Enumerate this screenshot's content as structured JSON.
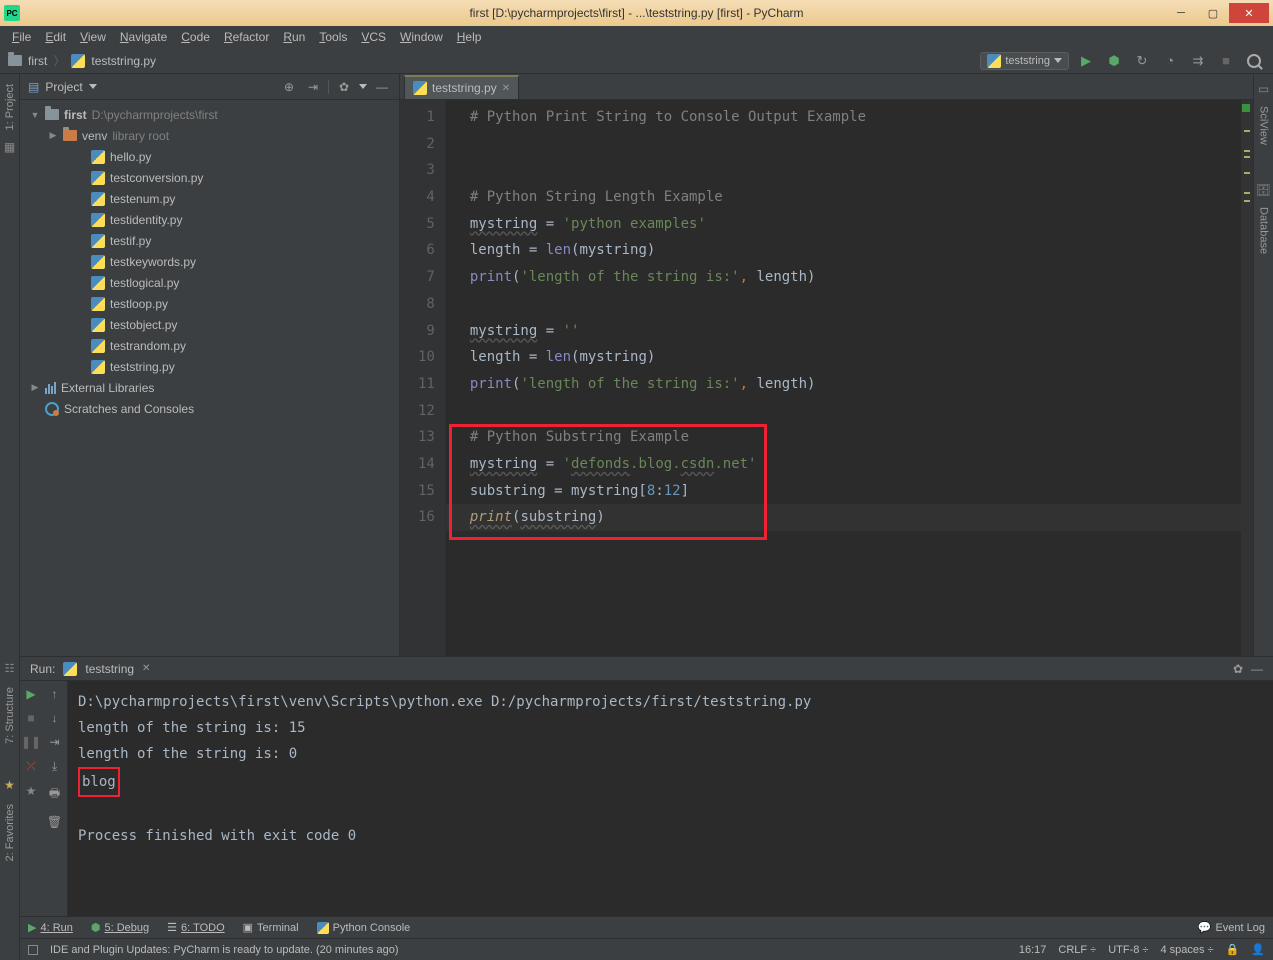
{
  "window": {
    "title": "first [D:\\pycharmprojects\\first] - ...\\teststring.py [first] - PyCharm",
    "min": "─",
    "max": "▢",
    "close": "✕"
  },
  "menu": {
    "items": [
      "File",
      "Edit",
      "View",
      "Navigate",
      "Code",
      "Refactor",
      "Run",
      "Tools",
      "VCS",
      "Window",
      "Help"
    ]
  },
  "breadcrumb": {
    "root": "first",
    "file": "teststring.py"
  },
  "toolbar": {
    "run_config": "teststring"
  },
  "left_rail": {
    "project": "1: Project"
  },
  "right_rail": {
    "sciview": "SciView",
    "database": "Database"
  },
  "left_fav": {
    "structure": "7: Structure",
    "favorites": "2: Favorites"
  },
  "project": {
    "title": "Project",
    "root": "first",
    "root_path": "D:\\pycharmprojects\\first",
    "venv": "venv",
    "venv_note": "library root",
    "files": [
      "hello.py",
      "testconversion.py",
      "testenum.py",
      "testidentity.py",
      "testif.py",
      "testkeywords.py",
      "testlogical.py",
      "testloop.py",
      "testobject.py",
      "testrandom.py",
      "teststring.py"
    ],
    "external": "External Libraries",
    "scratches": "Scratches and Consoles"
  },
  "editor": {
    "tab": "teststring.py",
    "lines": [
      {
        "n": "1",
        "seg": [
          {
            "t": "# Python Print String to Console Output Example",
            "c": "c-com"
          }
        ]
      },
      {
        "n": "2",
        "seg": []
      },
      {
        "n": "3",
        "seg": []
      },
      {
        "n": "4",
        "seg": [
          {
            "t": "# Python String Length Example",
            "c": "c-com"
          }
        ]
      },
      {
        "n": "5",
        "seg": [
          {
            "t": "mystring",
            "c": "c-id c-und"
          },
          {
            "t": " = ",
            "c": "c-id"
          },
          {
            "t": "'python examples'",
            "c": "c-str"
          }
        ]
      },
      {
        "n": "6",
        "seg": [
          {
            "t": "length = ",
            "c": "c-id"
          },
          {
            "t": "len",
            "c": "c-fn"
          },
          {
            "t": "(mystring)",
            "c": "c-id"
          }
        ]
      },
      {
        "n": "7",
        "seg": [
          {
            "t": "print",
            "c": "c-fn"
          },
          {
            "t": "(",
            "c": "c-id"
          },
          {
            "t": "'length of the string is:'",
            "c": "c-str"
          },
          {
            "t": ", ",
            "c": "c-key"
          },
          {
            "t": "length)",
            "c": "c-id"
          }
        ]
      },
      {
        "n": "8",
        "seg": []
      },
      {
        "n": "9",
        "seg": [
          {
            "t": "mystring",
            "c": "c-id c-und"
          },
          {
            "t": " = ",
            "c": "c-id"
          },
          {
            "t": "''",
            "c": "c-str"
          }
        ]
      },
      {
        "n": "10",
        "seg": [
          {
            "t": "length = ",
            "c": "c-id"
          },
          {
            "t": "len",
            "c": "c-fn"
          },
          {
            "t": "(mystring)",
            "c": "c-id"
          }
        ]
      },
      {
        "n": "11",
        "seg": [
          {
            "t": "print",
            "c": "c-fn"
          },
          {
            "t": "(",
            "c": "c-id"
          },
          {
            "t": "'length of the string is:'",
            "c": "c-str"
          },
          {
            "t": ", ",
            "c": "c-key"
          },
          {
            "t": "length)",
            "c": "c-id"
          }
        ]
      },
      {
        "n": "12",
        "seg": []
      },
      {
        "n": "13",
        "seg": [
          {
            "t": "# Python Substring Example",
            "c": "c-com"
          }
        ]
      },
      {
        "n": "14",
        "seg": [
          {
            "t": "mystring",
            "c": "c-id c-und"
          },
          {
            "t": " = ",
            "c": "c-id"
          },
          {
            "t": "'",
            "c": "c-str"
          },
          {
            "t": "defonds",
            "c": "c-str c-und"
          },
          {
            "t": ".blog.",
            "c": "c-str"
          },
          {
            "t": "csdn",
            "c": "c-str c-und"
          },
          {
            "t": ".net'",
            "c": "c-str"
          }
        ]
      },
      {
        "n": "15",
        "seg": [
          {
            "t": "substring = mystring[",
            "c": "c-id"
          },
          {
            "t": "8",
            "c": "c-num"
          },
          {
            "t": ":",
            "c": "c-id"
          },
          {
            "t": "12",
            "c": "c-num"
          },
          {
            "t": "]",
            "c": "c-id"
          }
        ]
      },
      {
        "n": "16",
        "seg": [
          {
            "t": "print",
            "c": "c-fni c-und"
          },
          {
            "t": "(",
            "c": "c-id"
          },
          {
            "t": "substring",
            "c": "c-id c-und"
          },
          {
            "t": ")",
            "c": "c-id"
          }
        ],
        "current": true
      }
    ]
  },
  "run": {
    "label": "Run:",
    "tab": "teststring",
    "output": [
      "D:\\pycharmprojects\\first\\venv\\Scripts\\python.exe D:/pycharmprojects/first/teststring.py",
      "length of the string is: 15",
      "length of the string is: 0",
      "blog",
      "",
      "Process finished with exit code 0"
    ]
  },
  "bottom": {
    "run": "4: Run",
    "debug": "5: Debug",
    "todo": "6: TODO",
    "terminal": "Terminal",
    "pyconsole": "Python Console",
    "eventlog": "Event Log"
  },
  "status": {
    "msg": "IDE and Plugin Updates: PyCharm is ready to update. (20 minutes ago)",
    "pos": "16:17",
    "eol": "CRLF",
    "enc": "UTF-8",
    "indent": "4 spaces"
  }
}
